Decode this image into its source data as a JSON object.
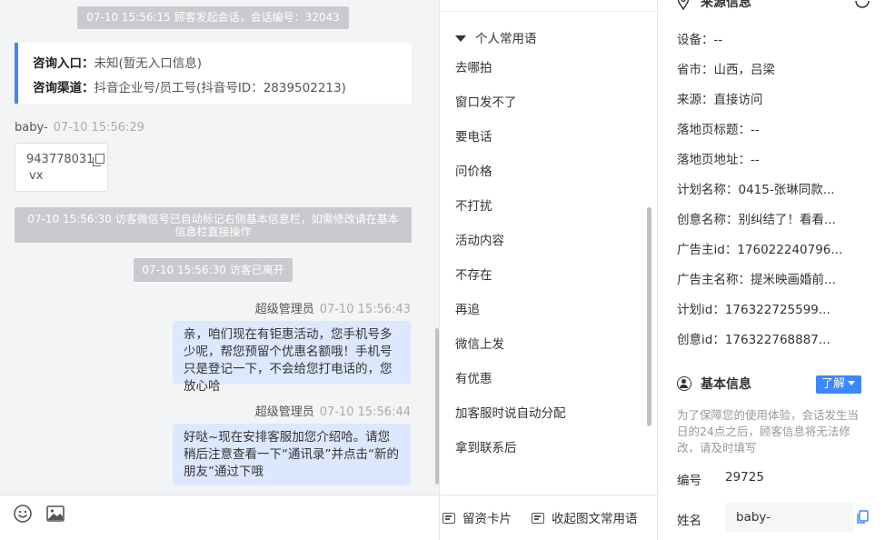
{
  "chat": {
    "system_messages": [
      "07-10 15:56:15 顾客发起会话，会话编号：32043",
      "07-10 15:56:30 访客微信号已自动标记右侧基本信息栏，如需修改请在基本信息栏直接操作",
      "07-10 15:56:30 访客已离开"
    ],
    "consult_entry_label": "咨询入口：",
    "consult_entry_value": "未知(暂无入口信息)",
    "consult_channel_label": "咨询渠道：",
    "consult_channel_value": "抖音企业号/员工号(抖音号ID：2839502213)",
    "visitor_name": "baby-",
    "visitor_time": "07-10 15:56:29",
    "visitor_card_number": "943778031",
    "visitor_card_sub": "vx",
    "agent_messages": [
      {
        "sender": "超级管理员",
        "time": "07-10 15:56:43",
        "text": "亲，咱们现在有钜惠活动，您手机号多少呢，帮您预留个优惠名额哦！手机号只是登记一下，不会给您打电话的，您放心哈"
      },
      {
        "sender": "超级管理员",
        "time": "07-10 15:56:44",
        "text": "好哒~现在安排客服加您介绍哈。请您稍后注意查看一下“通讯录”并点击“新的朋友”通过下哦"
      }
    ]
  },
  "phrases": {
    "group_label": "个人常用语",
    "items": [
      "去哪拍",
      "窗口发不了",
      "要电话",
      "问价格",
      "不打扰",
      "活动内容",
      "不存在",
      "再追",
      "微信上发",
      "有优惠",
      "加客服时说自动分配",
      "拿到联系后"
    ],
    "footer_card": "留资卡片",
    "footer_collapse": "收起图文常用语"
  },
  "info": {
    "source_title": "来源信息",
    "source_rows": [
      "设备：--",
      "省市：山西，吕梁",
      "来源：直接访问",
      "落地页标题：--",
      "落地页地址：--",
      "计划名称：0415-张琳同款...",
      "创意名称：别纠结了！看看...",
      "广告主id：176022240796...",
      "广告主名称：提米映画婚前...",
      "计划id：176322725599...",
      "创意id：176322768887..."
    ],
    "basic_title": "基本信息",
    "learn_button": "了解",
    "notice": "为了保障您的使用体验，会话发生当日的24点之后，顾客信息将无法修改，请及时填写",
    "id_label": "编号",
    "id_value": "29725",
    "name_label": "姓名",
    "name_value": "baby-"
  },
  "colors": {
    "accent": "#3d87ff",
    "agent_bubble": "#dce8fd",
    "system_pill": "#c9cacd",
    "chat_bg": "#f3f4f6"
  }
}
